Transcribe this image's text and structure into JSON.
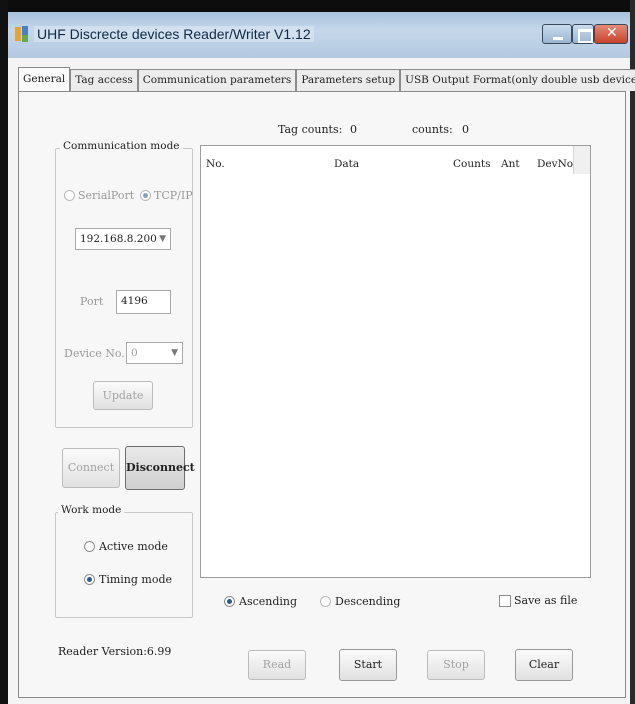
{
  "window": {
    "title": "UHF Discrecte devices Reader/Writer V1.12"
  },
  "tabs": [
    {
      "label": "General",
      "active": true
    },
    {
      "label": "Tag access",
      "active": false
    },
    {
      "label": "Communication parameters",
      "active": false
    },
    {
      "label": "Parameters setup",
      "active": false
    },
    {
      "label": "USB Output Format(only double usb device)",
      "active": false
    }
  ],
  "communication_mode": {
    "title": "Communication mode",
    "serial_label": "SerialPort",
    "tcp_label": "TCP/IP",
    "selected": "TCP/IP",
    "ip_value": "192.168.8.200",
    "port_label": "Port",
    "port_value": "4196",
    "device_label": "Device No.",
    "device_value": "0",
    "update_label": "Update"
  },
  "connection": {
    "connect_label": "Connect",
    "disconnect_label": "Disconnect"
  },
  "work_mode": {
    "title": "Work mode",
    "active_label": "Active mode",
    "timing_label": "Timing mode",
    "selected": "Timing mode"
  },
  "counters": {
    "tag_counts_label": "Tag counts:",
    "tag_counts_value": "0",
    "counts_label": "counts:",
    "counts_value": "0"
  },
  "table": {
    "columns": [
      "No.",
      "Data",
      "Counts",
      "Ant",
      "DevNo"
    ],
    "rows": []
  },
  "sorting": {
    "ascending_label": "Ascending",
    "descending_label": "Descending",
    "selected": "Ascending",
    "save_label": "Save as file"
  },
  "footer": {
    "reader_version": "Reader Version:6.99",
    "read_label": "Read",
    "start_label": "Start",
    "stop_label": "Stop",
    "clear_label": "Clear"
  },
  "colors": {
    "titlebar": "#b3c9e0",
    "close_button": "#c9412a",
    "window_bg": "#f4f4f4"
  }
}
